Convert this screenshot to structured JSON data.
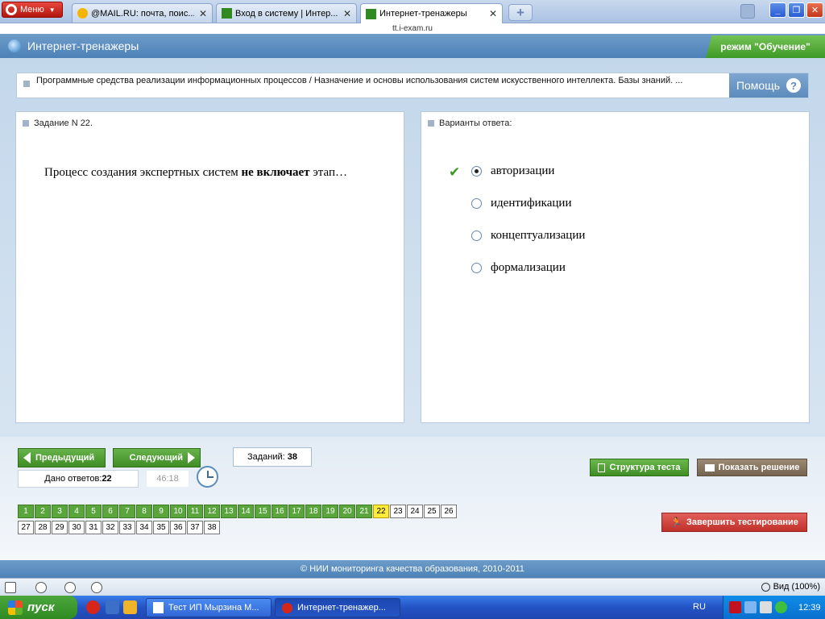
{
  "browser": {
    "menu_label": "Меню",
    "tabs": [
      {
        "title": "@MAIL.RU: почта, поис..."
      },
      {
        "title": "Вход в систему | Интер..."
      },
      {
        "title": "Интернет-тренажеры"
      }
    ],
    "url": "tt.i-exam.ru",
    "close_glyph": "✕"
  },
  "header": {
    "site_title": "Интернет-тренажеры",
    "mode": "режим \"Обучение\""
  },
  "topic": {
    "text": "Программные средства реализации информационных процессов / Назначение и основы использования систем искусственного интеллекта. Базы знаний. ...",
    "help_label": "Помощь",
    "help_glyph": "?"
  },
  "task": {
    "heading": "Задание N 22.",
    "question_part1": "Процесс создания экспертных систем ",
    "question_bold": "не включает",
    "question_part2": " этап…"
  },
  "answers": {
    "heading": "Варианты ответа:",
    "options": [
      {
        "label": "авторизации",
        "selected": true
      },
      {
        "label": "идентификации",
        "selected": false
      },
      {
        "label": "концептуализации",
        "selected": false
      },
      {
        "label": "формализации",
        "selected": false
      }
    ]
  },
  "controls": {
    "prev_label": "Предыдущий",
    "next_label": "Следующий",
    "answered_label": "Дано ответов:",
    "answered_value": "22",
    "timer": "46:18",
    "tasks_label": "Заданий:",
    "tasks_value": "38",
    "structure_label": "Структура теста",
    "solution_label": "Показать решение",
    "finish_label": "Завершить тестирование"
  },
  "question_grid": {
    "total": 38,
    "answered_up_to": 21,
    "current": 22
  },
  "footer": {
    "text": "© НИИ мониторинга качества образования, 2010-2011"
  },
  "statusbar": {
    "zoom": "Вид (100%)"
  },
  "taskbar": {
    "start_label": "пуск",
    "tasks": [
      {
        "title": "Тест ИП Мырзина М..."
      },
      {
        "title": "Интернет-тренажер..."
      }
    ],
    "lang": "RU",
    "clock": "12:39"
  },
  "colors": {
    "header_blue": "#4d82b8",
    "green": "#3f8d25",
    "current_yellow": "#ffec3a",
    "finish_red": "#c0302a"
  }
}
